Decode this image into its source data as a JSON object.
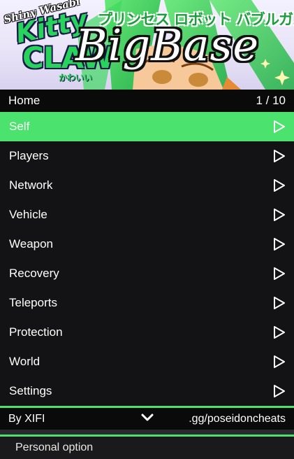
{
  "banner": {
    "logo_line1": "Shiny Wasabi",
    "logo_line2": "Kitty",
    "logo_line3": "CLAW",
    "logo_line4": "かわいい",
    "jp_title": "プリンセス ロボット バブルガム",
    "title": "BigBase"
  },
  "header": {
    "title": "Home",
    "page_counter": "1 / 10"
  },
  "menu": {
    "items": [
      {
        "label": "Self",
        "active": true
      },
      {
        "label": "Players",
        "active": false
      },
      {
        "label": "Network",
        "active": false
      },
      {
        "label": "Vehicle",
        "active": false
      },
      {
        "label": "Weapon",
        "active": false
      },
      {
        "label": "Recovery",
        "active": false
      },
      {
        "label": "Teleports",
        "active": false
      },
      {
        "label": "Protection",
        "active": false
      },
      {
        "label": "World",
        "active": false
      },
      {
        "label": "Settings",
        "active": false
      }
    ],
    "arrow_icon": "play-arrow-icon"
  },
  "footer": {
    "author": "By XIFI",
    "icon": "chevron-down-icon",
    "site": ".gg/poseidoncheats"
  },
  "description": {
    "text": "Personal option"
  },
  "colors": {
    "accent": "#4be36d",
    "menu_bg": "#131315",
    "bar_bg": "#0a0a0a"
  }
}
